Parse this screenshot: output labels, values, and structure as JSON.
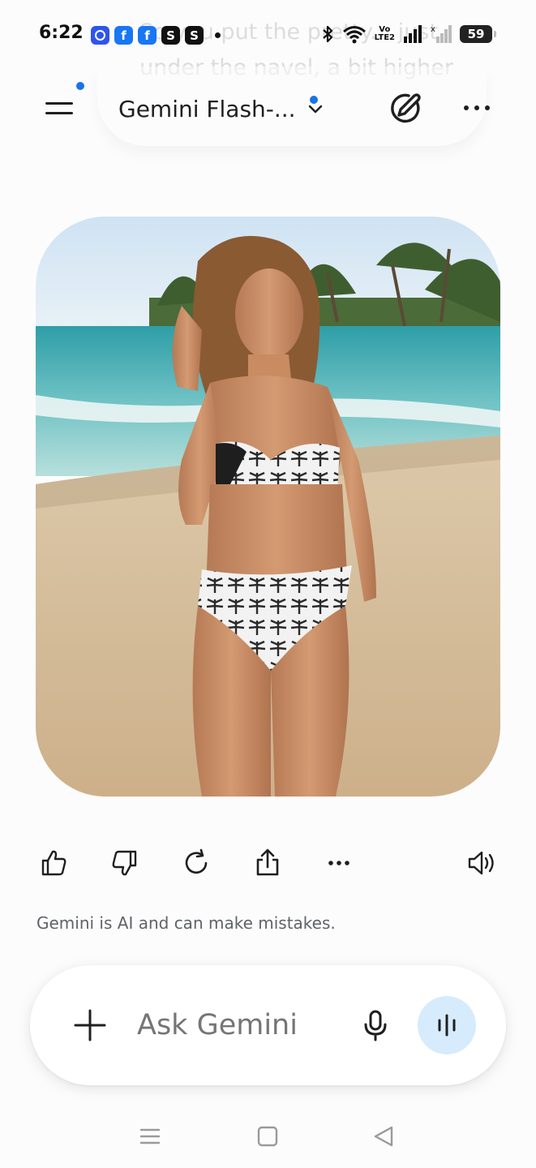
{
  "status_bar": {
    "time": "6:22",
    "notification_icons": [
      "signal-app-icon",
      "facebook-icon",
      "facebook-icon",
      "s-app-icon",
      "s-app-icon"
    ],
    "s_letter": "S",
    "volte_top": "Vo",
    "volte_bottom": "LTE2",
    "battery": "59"
  },
  "background_message": {
    "text": "So you put the pretty... just under the navel, a bit higher"
  },
  "header": {
    "model_name": "Gemini Flash-...",
    "menu_icon": "hamburger-icon",
    "new_chat_icon": "edit-icon",
    "more_icon": "more-horizontal-icon"
  },
  "response_image": {
    "subject": "woman in black and white palm print bikini on tropical beach"
  },
  "actions": [
    {
      "name": "thumbs-up-icon"
    },
    {
      "name": "thumbs-down-icon"
    },
    {
      "name": "regenerate-icon"
    },
    {
      "name": "share-icon"
    },
    {
      "name": "more-icon"
    },
    {
      "name": "speaker-icon"
    }
  ],
  "disclaimer": "Gemini is AI and can make mistakes.",
  "input": {
    "placeholder": "Ask Gemini",
    "value": ""
  },
  "colors": {
    "accent_blue": "#1a73e8",
    "live_button_bg": "#d6ebfc",
    "text_primary": "#1f1f1f",
    "text_secondary": "#5f6368"
  }
}
